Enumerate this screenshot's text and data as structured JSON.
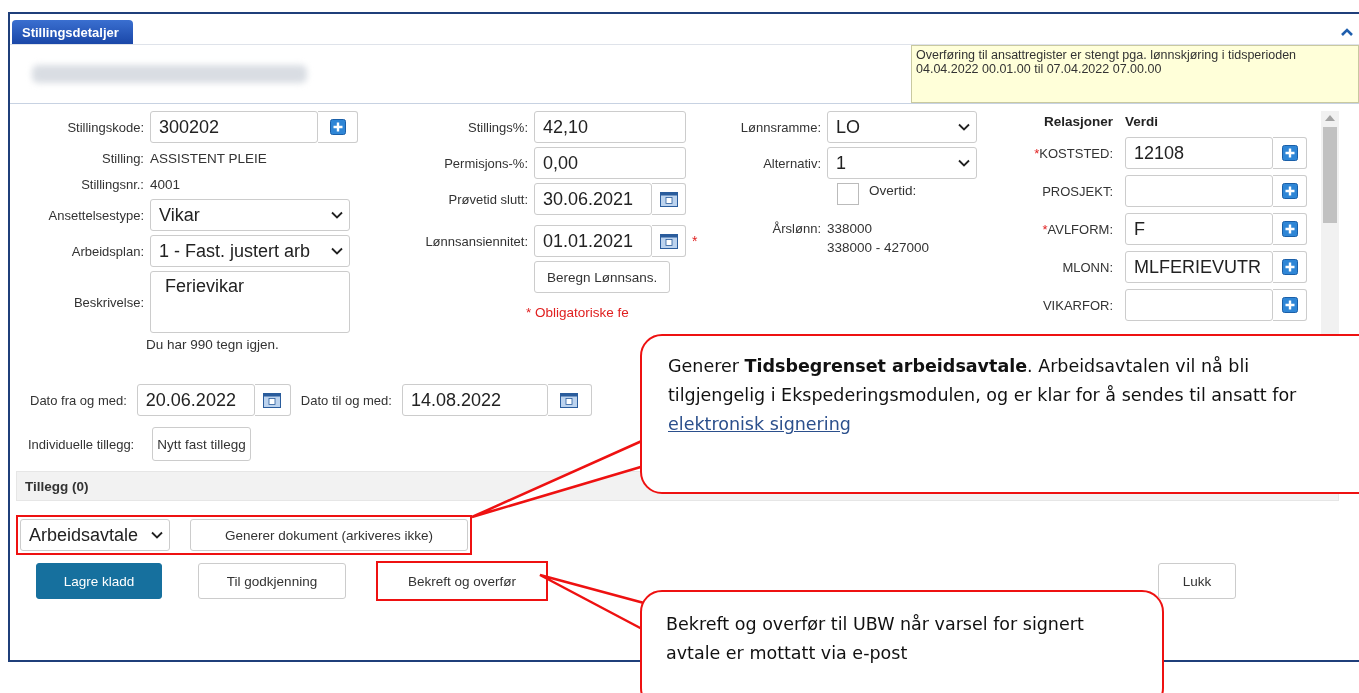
{
  "tab": {
    "label": "Stillingsdetaljer",
    "selected": true
  },
  "notice": "Overføring til ansattregister er stengt pga. lønnskjøring i tidsperioden 04.04.2022 00.01.00 til 07.04.2022 07.00.00",
  "fields_left": [
    {
      "kind": "lookup",
      "label": "Stillingskode:",
      "value": "300202"
    },
    {
      "kind": "text",
      "label": "Stilling:",
      "value": "ASSISTENT PLEIE"
    },
    {
      "kind": "text",
      "label": "Stillingsnr.:",
      "value": "4001"
    },
    {
      "kind": "select",
      "label": "Ansettelsestype:",
      "value": "Vikar"
    },
    {
      "kind": "select",
      "label": "Arbeidsplan:",
      "value": "1 - Fast. justert arb"
    },
    {
      "kind": "textarea",
      "label": "Beskrivelse:",
      "value": "Ferievikar",
      "hint": "Du har 990 tegn igjen."
    }
  ],
  "fields_mid": [
    {
      "kind": "input",
      "label": "Stillings%:",
      "value": "42,10"
    },
    {
      "kind": "input",
      "label": "Permisjons-%:",
      "value": "0,00"
    },
    {
      "kind": "date",
      "label": "Prøvetid slutt:",
      "value": "30.06.2021"
    },
    {
      "kind": "date",
      "label": "Lønnsansiennitet:",
      "value": "01.01.2021",
      "mark": "*"
    },
    {
      "kind": "button",
      "label": "Beregn Lønnsans."
    }
  ],
  "required_note": "* Obligatoriske fe",
  "fields_right": [
    {
      "kind": "select",
      "label": "Lønnsramme:",
      "value": "LO"
    },
    {
      "kind": "select",
      "label": "Alternativ:",
      "value": "1"
    },
    {
      "kind": "checkbox",
      "label": "Overtid:",
      "checked": false
    },
    {
      "kind": "text",
      "label": "Årslønn:",
      "value": "338000",
      "value_2": "338000 - 427000"
    }
  ],
  "relations": {
    "header_label": "Relasjoner",
    "header_value": "Verdi",
    "rows": [
      {
        "label": "KOSTSTED:",
        "mark": "*",
        "value": "12108"
      },
      {
        "label": "PROSJEKT:",
        "value": ""
      },
      {
        "label": "AVLFORM:",
        "mark": "*",
        "value": "F"
      },
      {
        "label": "MLONN:",
        "value": "MLFERIEVUTR"
      },
      {
        "label": "VIKARFOR:",
        "value": ""
      }
    ]
  },
  "dates": [
    {
      "label": "Dato fra og med:",
      "value": "20.06.2022"
    },
    {
      "label": "Dato til og med:",
      "value": "14.08.2022"
    }
  ],
  "supplements": {
    "label": "Individuelle tillegg:",
    "button": "Nytt fast tillegg",
    "section": "Tillegg (0)"
  },
  "document": {
    "select": "Arbeidsavtale",
    "button": "Generer dokument (arkiveres ikke)",
    "highlighted": true
  },
  "actions": [
    {
      "kind": "primary",
      "label": "Lagre kladd",
      "highlighted": false
    },
    {
      "kind": "secondary",
      "label": "Til godkjenning",
      "highlighted": false
    },
    {
      "kind": "secondary",
      "label": "Bekreft og overfør",
      "highlighted": true
    },
    {
      "kind": "close",
      "label": "Lukk",
      "highlighted": false
    }
  ],
  "callouts": [
    {
      "text": "Generer **Tidsbegrenset arbeidsavtale**. Arbeidsavtalen vil nå bli tilgjengelig i Ekspederingsmodulen, og er klar for å sendes til ansatt for ",
      "link": "elektronisk signering"
    },
    {
      "text": "Bekreft og overfør til UBW når varsel for signert avtale er mottatt via e-post"
    }
  ]
}
